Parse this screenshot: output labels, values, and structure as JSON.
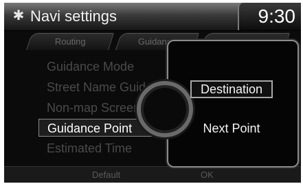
{
  "header": {
    "icon": "gear-icon",
    "title": "Navi settings",
    "clock": "9:30"
  },
  "tabs": [
    {
      "label": "Routing"
    },
    {
      "label": "Guidance"
    },
    {
      "label": ""
    }
  ],
  "list": {
    "items": [
      {
        "label": "Guidance Mode"
      },
      {
        "label": "Street Name Guidance"
      },
      {
        "label": "Non-map Screens"
      },
      {
        "label": "Guidance Point"
      },
      {
        "label": "Estimated Time"
      }
    ],
    "selected_index": 3
  },
  "popup": {
    "options": [
      {
        "label": "Destination"
      },
      {
        "label": "Next Point"
      }
    ],
    "selected_index": 0
  },
  "bottom": {
    "default_label": "Default",
    "ok_label": "OK"
  }
}
